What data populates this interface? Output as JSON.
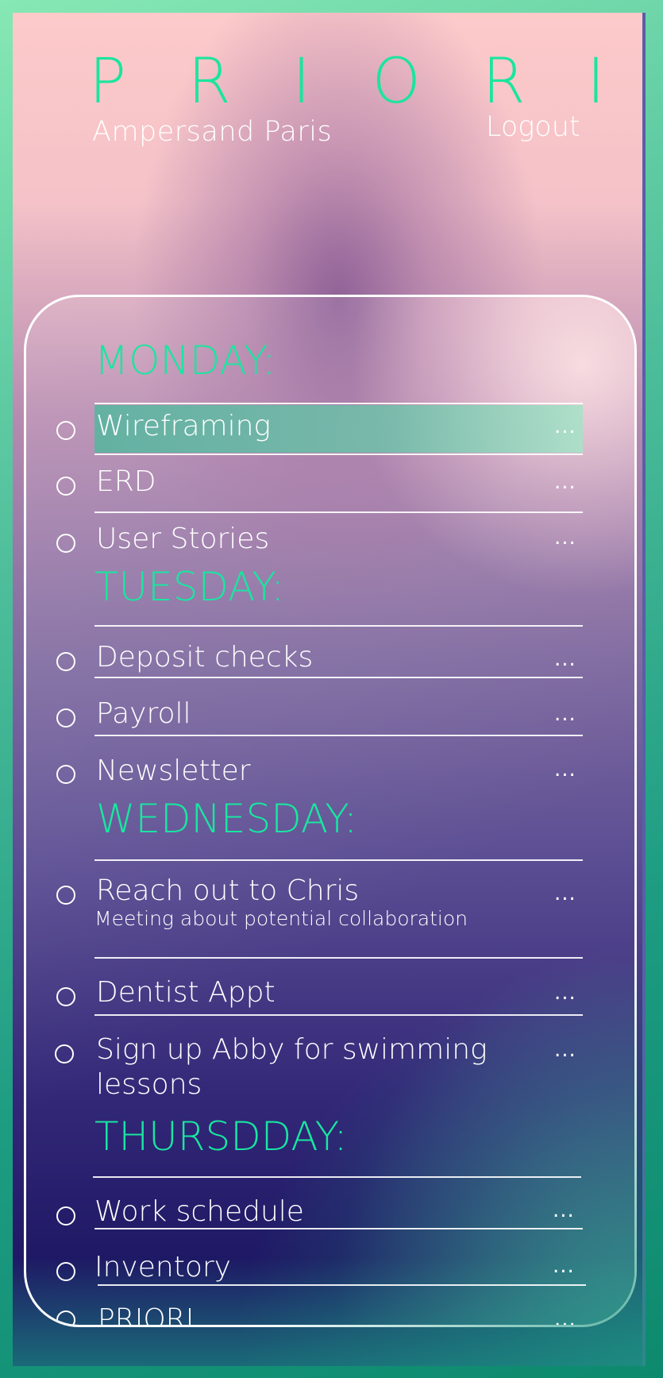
{
  "header": {
    "brand_letters": [
      "P",
      "R",
      "I",
      "O",
      "R",
      "I"
    ],
    "company": "Ampersand Paris",
    "logout_label": "Logout"
  },
  "days": [
    {
      "label": "MONDAY:",
      "tasks": [
        {
          "title": "Wireframing",
          "more": "...",
          "highlighted": true
        },
        {
          "title": "ERD",
          "more": "..."
        },
        {
          "title": "User Stories",
          "more": "..."
        }
      ]
    },
    {
      "label": "TUESDAY:",
      "tasks": [
        {
          "title": "Deposit checks",
          "more": "..."
        },
        {
          "title": "Payroll",
          "more": "..."
        },
        {
          "title": "Newsletter",
          "more": "..."
        }
      ]
    },
    {
      "label": "WEDNESDAY:",
      "tasks": [
        {
          "title": "Reach out to Chris",
          "subtitle": "Meeting about potential collaboration",
          "more": "..."
        },
        {
          "title": "Dentist Appt",
          "more": "..."
        },
        {
          "title_line1": "Sign up Abby for swimming",
          "title_line2": "lessons",
          "more": "..."
        }
      ]
    },
    {
      "label": "THURSDDAY:",
      "tasks": [
        {
          "title": "Work schedule",
          "more": "..."
        },
        {
          "title": "Inventory",
          "more": "..."
        },
        {
          "title": "PRIORI",
          "more": "..."
        }
      ]
    }
  ],
  "colors": {
    "accent": "#19e6a0",
    "text": "#ffffff",
    "highlight": "#6fbfab"
  },
  "icons": {
    "task_checkbox": "circle-outline",
    "task_menu": "ellipsis"
  }
}
